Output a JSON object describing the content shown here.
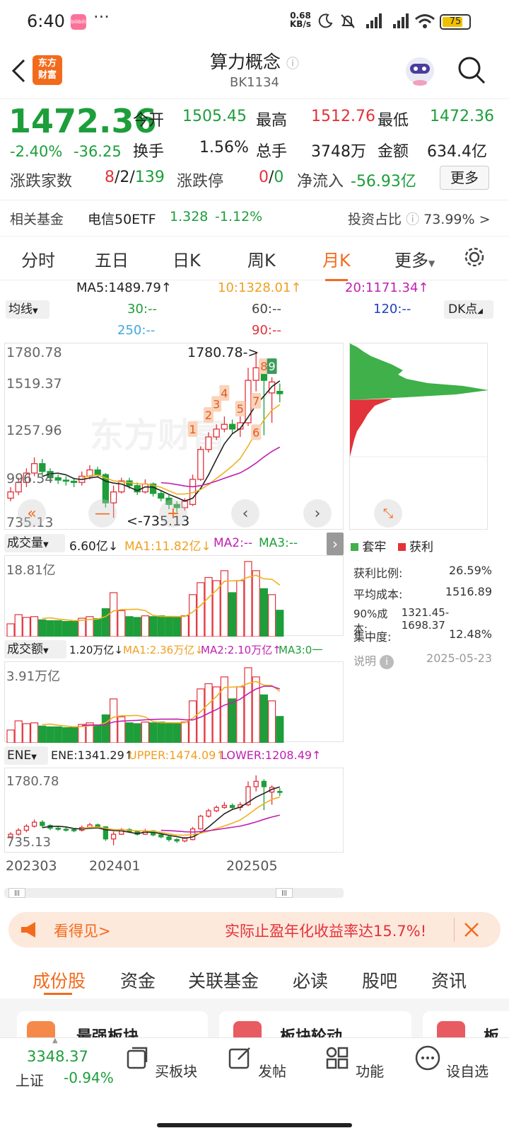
{
  "status": {
    "time": "6:40",
    "net_speed": "0.68",
    "net_unit": "KB/s",
    "battery": "75",
    "dots": "···",
    "app_badge": "bilibili"
  },
  "header": {
    "title": "算力概念",
    "code": "BK1134",
    "logo_line1": "东方",
    "logo_line2": "财富"
  },
  "quote": {
    "price": "1472.36",
    "change_pct": "-2.40%",
    "change": "-36.25",
    "open_label": "今开",
    "open": "1505.45",
    "high_label": "最高",
    "high": "1512.76",
    "low_label": "最低",
    "low": "1472.36",
    "turnover_label": "换手",
    "turnover": "1.56%",
    "volume_label": "总手",
    "volume": "3748万",
    "amount_label": "金额",
    "amount": "634.4亿",
    "updown_label": "涨跌家数",
    "up": "8",
    "flat": "2",
    "down": "139",
    "limit_label": "涨跌停",
    "limit_up": "0",
    "limit_down": "0",
    "netflow_label": "净流入",
    "netflow": "-56.93亿",
    "more_button": "更多"
  },
  "fund": {
    "label": "相关基金",
    "name": "电信50ETF",
    "price": "1.328",
    "change": "-1.12%",
    "ratio_label": "投资占比",
    "ratio": "73.99%"
  },
  "tabs": [
    "分时",
    "五日",
    "日K",
    "周K",
    "月K",
    "更多"
  ],
  "active_tab": 4,
  "ma": {
    "ma5": "MA5:1489.79↑",
    "ma10": "10:1328.01↑",
    "ma20": "20:1171.34↑",
    "ma30": "30:--",
    "ma60": "60:--",
    "ma120": "120:--",
    "ma250": "250:--",
    "ma90": "90:--",
    "indicator_select": "均线",
    "dk_select": "DK点"
  },
  "kchart": {
    "y_labels": [
      "1780.78",
      "1519.37",
      "1257.96",
      "996.54",
      "735.13"
    ],
    "high_note": "1780.78->",
    "low_note": "<-735.13",
    "watermark": "东方财富",
    "signals": [
      "1",
      "2",
      "3",
      "4",
      "5",
      "6",
      "7",
      "8",
      "9"
    ]
  },
  "chip": {
    "legend_trapped": "套牢",
    "legend_profit": "获利",
    "stats": [
      {
        "label": "获利比例:",
        "value": "26.59%"
      },
      {
        "label": "平均成本:",
        "value": "1516.89"
      },
      {
        "label": "90%成本:",
        "value": "1321.45-1698.37"
      },
      {
        "label": "集中度:",
        "value": "12.48%"
      }
    ],
    "note_label": "说明",
    "date": "2025-05-23"
  },
  "vol": {
    "select": "成交量",
    "value": "6.60亿↓",
    "ma1": "MA1:11.82亿↓",
    "ma2": "MA2:--",
    "ma3": "MA3:--",
    "y_max": "18.81亿"
  },
  "amt": {
    "select": "成交额",
    "value": "1.20万亿↓",
    "ma1": "MA1:2.36万亿↓",
    "ma2": "MA2:2.10万亿↑",
    "ma3": "MA3:0一",
    "y_max": "3.91万亿"
  },
  "ene": {
    "select": "ENE",
    "ene": "ENE:1341.29↑",
    "upper": "UPPER:1474.09↑",
    "lower": "LOWER:1208.49↑",
    "y_max": "1780.78",
    "y_min": "735.13"
  },
  "x_labels": [
    "202303",
    "202401",
    "202505"
  ],
  "banner": {
    "left_text": "看得见>",
    "right_text": "实际止盈年化收益率达15.7%!"
  },
  "bottom_tabs": [
    "成份股",
    "资金",
    "关联基金",
    "必读",
    "股吧",
    "资讯"
  ],
  "cards": [
    "最强板块",
    "板块轮动",
    "板"
  ],
  "navbar": {
    "index_price": "3348.37",
    "index_name": "上证",
    "index_change": "-0.94%",
    "items": [
      "买板块",
      "发帖",
      "功能",
      "设自选"
    ]
  },
  "colors": {
    "up": "#e2323a",
    "down": "#1d9e3a",
    "accent": "#f26b1d"
  },
  "candles": [
    {
      "o": 860,
      "c": 900,
      "h": 930,
      "l": 840
    },
    {
      "o": 900,
      "c": 960,
      "h": 990,
      "l": 880
    },
    {
      "o": 960,
      "c": 1020,
      "h": 1050,
      "l": 930
    },
    {
      "o": 1020,
      "c": 1080,
      "h": 1120,
      "l": 1000
    },
    {
      "o": 1080,
      "c": 1030,
      "h": 1110,
      "l": 1000
    },
    {
      "o": 1030,
      "c": 990,
      "h": 1050,
      "l": 960
    },
    {
      "o": 990,
      "c": 975,
      "h": 1010,
      "l": 950
    },
    {
      "o": 975,
      "c": 968,
      "h": 1000,
      "l": 940
    },
    {
      "o": 968,
      "c": 960,
      "h": 990,
      "l": 930
    },
    {
      "o": 960,
      "c": 1000,
      "h": 1030,
      "l": 940
    },
    {
      "o": 1000,
      "c": 1040,
      "h": 1070,
      "l": 980
    },
    {
      "o": 1040,
      "c": 1010,
      "h": 1060,
      "l": 990
    },
    {
      "o": 1010,
      "c": 830,
      "h": 1020,
      "l": 800
    },
    {
      "o": 830,
      "c": 900,
      "h": 940,
      "l": 735
    },
    {
      "o": 900,
      "c": 970,
      "h": 990,
      "l": 890
    },
    {
      "o": 970,
      "c": 940,
      "h": 990,
      "l": 920
    },
    {
      "o": 940,
      "c": 900,
      "h": 960,
      "l": 880
    },
    {
      "o": 900,
      "c": 950,
      "h": 980,
      "l": 890
    },
    {
      "o": 950,
      "c": 890,
      "h": 960,
      "l": 870
    },
    {
      "o": 890,
      "c": 860,
      "h": 910,
      "l": 840
    },
    {
      "o": 860,
      "c": 820,
      "h": 880,
      "l": 790
    },
    {
      "o": 820,
      "c": 800,
      "h": 840,
      "l": 770
    },
    {
      "o": 800,
      "c": 840,
      "h": 860,
      "l": 780
    },
    {
      "o": 820,
      "c": 980,
      "h": 1010,
      "l": 810
    },
    {
      "o": 980,
      "c": 1170,
      "h": 1190,
      "l": 970
    },
    {
      "o": 1170,
      "c": 1250,
      "h": 1280,
      "l": 1150
    },
    {
      "o": 1250,
      "c": 1300,
      "h": 1330,
      "l": 1230
    },
    {
      "o": 1300,
      "c": 1330,
      "h": 1380,
      "l": 1280
    },
    {
      "o": 1330,
      "c": 1300,
      "h": 1360,
      "l": 1270
    },
    {
      "o": 1300,
      "c": 1340,
      "h": 1380,
      "l": 1250
    },
    {
      "o": 1340,
      "c": 1610,
      "h": 1690,
      "l": 1320
    },
    {
      "o": 1610,
      "c": 1690,
      "h": 1780,
      "l": 1540
    },
    {
      "o": 1690,
      "c": 1610,
      "h": 1720,
      "l": 1260
    },
    {
      "o": 1530,
      "c": 1600,
      "h": 1630,
      "l": 1340
    },
    {
      "o": 1540,
      "c": 1525,
      "h": 1590,
      "l": 1470
    }
  ],
  "volumes": [
    3.2,
    5.5,
    4.8,
    5.0,
    4.2,
    4.0,
    4.0,
    3.8,
    4.0,
    4.6,
    5.0,
    4.5,
    7.0,
    11.0,
    6.5,
    5.0,
    4.8,
    5.2,
    5.0,
    5.2,
    5.0,
    4.8,
    5.2,
    10.5,
    13.5,
    14.8,
    14.0,
    16.5,
    11.0,
    14.0,
    18.8,
    16.5,
    12.0,
    10.5,
    6.6
  ]
}
